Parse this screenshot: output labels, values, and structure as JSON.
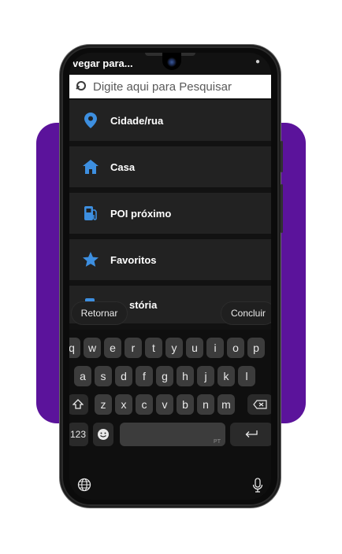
{
  "status": {
    "title": "vegar para..."
  },
  "search": {
    "placeholder": "Digite aqui para Pesquisar"
  },
  "menu": [
    {
      "label": "Cidade/rua",
      "icon": "location-pin-icon"
    },
    {
      "label": "Casa",
      "icon": "home-icon"
    },
    {
      "label": "POI próximo",
      "icon": "fuel-pump-icon"
    },
    {
      "label": "Favoritos",
      "icon": "star-icon"
    },
    {
      "label": "stória",
      "icon": "history-icon"
    }
  ],
  "actions": {
    "back": "Retornar",
    "done": "Concluir"
  },
  "keyboard": {
    "row1": [
      "q",
      "w",
      "e",
      "r",
      "t",
      "y",
      "u",
      "i",
      "o",
      "p"
    ],
    "row2": [
      "a",
      "s",
      "d",
      "f",
      "g",
      "h",
      "j",
      "k",
      "l"
    ],
    "row3": [
      "z",
      "x",
      "c",
      "v",
      "b",
      "n",
      "m"
    ],
    "numbers": "123",
    "language": "PT"
  },
  "colors": {
    "accent": "#3d8fe0",
    "purple": "#5b139b",
    "menu_bg": "#222222"
  }
}
